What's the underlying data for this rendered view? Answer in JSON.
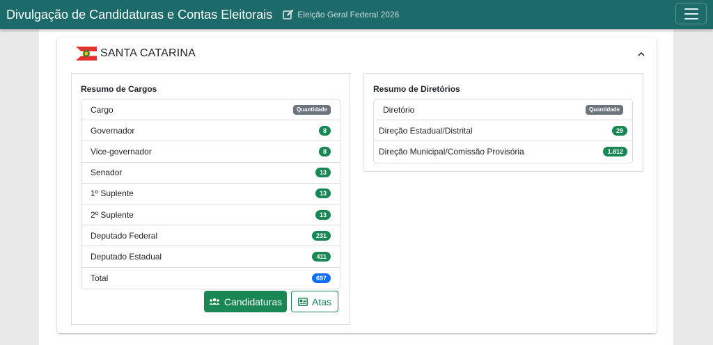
{
  "header": {
    "title": "Divulgação de Candidaturas e Contas Eleitorais",
    "election": "Eleição Geral Federal 2026",
    "icons": {
      "edit": "edit-square-icon",
      "menu": "hamburger-menu-icon"
    }
  },
  "state": {
    "name": "SANTA CATARINA",
    "flag_icon": "santa-catarina-flag-icon",
    "collapse_icon": "chevron-up-icon"
  },
  "cargos": {
    "title": "Resumo de Cargos",
    "column_label": "Cargo",
    "count_label": "Quantidade",
    "rows": [
      {
        "label": "Governador",
        "value": "8"
      },
      {
        "label": "Vice-governador",
        "value": "8"
      },
      {
        "label": "Senador",
        "value": "13"
      },
      {
        "label": "1º Suplente",
        "value": "13"
      },
      {
        "label": "2º Suplente",
        "value": "13"
      },
      {
        "label": "Deputado Federal",
        "value": "231"
      },
      {
        "label": "Deputado Estadual",
        "value": "411"
      }
    ],
    "total_label": "Total",
    "total_value": "697"
  },
  "diretorios": {
    "title": "Resumo de Diretórios",
    "column_label": "Diretório",
    "count_label": "Quantidade",
    "rows": [
      {
        "label": "Direção Estadual/Distrital",
        "value": "29"
      },
      {
        "label": "Direção Municipal/Comissão Provisória",
        "value": "1.812"
      }
    ]
  },
  "buttons": {
    "candidaturas": "Candidaturas",
    "atas": "Atas",
    "candidaturas_icon": "users-group-icon",
    "atas_icon": "newspaper-icon"
  },
  "colors": {
    "topbar": "#1d6a6a",
    "success": "#198754",
    "primary": "#0d6efd",
    "secondary": "#6c757d"
  }
}
